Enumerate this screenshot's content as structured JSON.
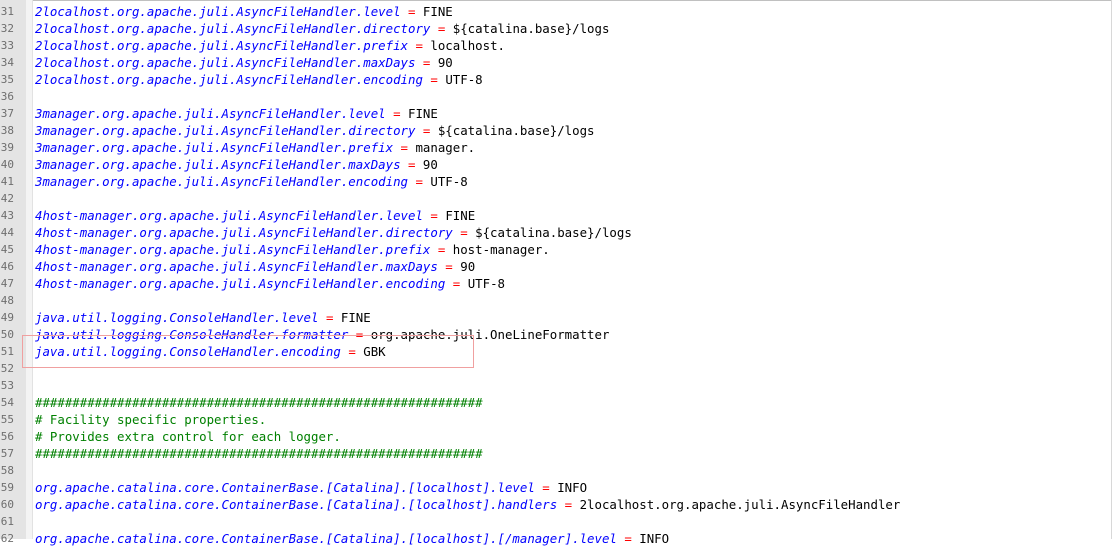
{
  "editor": {
    "lines": [
      {
        "no": "31",
        "key": "2localhost.org.apache.juli.AsyncFileHandler.level",
        "eq": " = ",
        "val": "FINE"
      },
      {
        "no": "32",
        "key": "2localhost.org.apache.juli.AsyncFileHandler.directory",
        "eq": " = ",
        "val": "${catalina.base}/logs"
      },
      {
        "no": "33",
        "key": "2localhost.org.apache.juli.AsyncFileHandler.prefix",
        "eq": " = ",
        "val": "localhost."
      },
      {
        "no": "34",
        "key": "2localhost.org.apache.juli.AsyncFileHandler.maxDays",
        "eq": " = ",
        "val": "90"
      },
      {
        "no": "35",
        "key": "2localhost.org.apache.juli.AsyncFileHandler.encoding",
        "eq": " = ",
        "val": "UTF-8"
      },
      {
        "no": "36",
        "key": "",
        "eq": "",
        "val": ""
      },
      {
        "no": "37",
        "key": "3manager.org.apache.juli.AsyncFileHandler.level",
        "eq": " = ",
        "val": "FINE"
      },
      {
        "no": "38",
        "key": "3manager.org.apache.juli.AsyncFileHandler.directory",
        "eq": " = ",
        "val": "${catalina.base}/logs"
      },
      {
        "no": "39",
        "key": "3manager.org.apache.juli.AsyncFileHandler.prefix",
        "eq": " = ",
        "val": "manager."
      },
      {
        "no": "40",
        "key": "3manager.org.apache.juli.AsyncFileHandler.maxDays",
        "eq": " = ",
        "val": "90"
      },
      {
        "no": "41",
        "key": "3manager.org.apache.juli.AsyncFileHandler.encoding",
        "eq": " = ",
        "val": "UTF-8"
      },
      {
        "no": "42",
        "key": "",
        "eq": "",
        "val": ""
      },
      {
        "no": "43",
        "key": "4host-manager.org.apache.juli.AsyncFileHandler.level",
        "eq": " = ",
        "val": "FINE"
      },
      {
        "no": "44",
        "key": "4host-manager.org.apache.juli.AsyncFileHandler.directory",
        "eq": " = ",
        "val": "${catalina.base}/logs"
      },
      {
        "no": "45",
        "key": "4host-manager.org.apache.juli.AsyncFileHandler.prefix",
        "eq": " = ",
        "val": "host-manager."
      },
      {
        "no": "46",
        "key": "4host-manager.org.apache.juli.AsyncFileHandler.maxDays",
        "eq": " = ",
        "val": "90"
      },
      {
        "no": "47",
        "key": "4host-manager.org.apache.juli.AsyncFileHandler.encoding",
        "eq": " = ",
        "val": "UTF-8"
      },
      {
        "no": "48",
        "key": "",
        "eq": "",
        "val": ""
      },
      {
        "no": "49",
        "key": "java.util.logging.ConsoleHandler.level",
        "eq": " = ",
        "val": "FINE"
      },
      {
        "no": "50",
        "key": "java.util.logging.ConsoleHandler.formatter",
        "eq": " = ",
        "val": "org.apache.juli.OneLineFormatter"
      },
      {
        "no": "51",
        "key": "java.util.logging.ConsoleHandler.encoding",
        "eq": " = ",
        "val": "GBK"
      },
      {
        "no": "52",
        "key": "",
        "eq": "",
        "val": ""
      },
      {
        "no": "53",
        "key": "",
        "eq": "",
        "val": ""
      },
      {
        "no": "54",
        "comment": "############################################################"
      },
      {
        "no": "55",
        "comment": "# Facility specific properties."
      },
      {
        "no": "56",
        "comment": "# Provides extra control for each logger."
      },
      {
        "no": "57",
        "comment": "############################################################"
      },
      {
        "no": "58",
        "key": "",
        "eq": "",
        "val": ""
      },
      {
        "no": "59",
        "key": "org.apache.catalina.core.ContainerBase.[Catalina].[localhost].level",
        "eq": " = ",
        "val": "INFO"
      },
      {
        "no": "60",
        "key": "org.apache.catalina.core.ContainerBase.[Catalina].[localhost].handlers",
        "eq": " = ",
        "val": "2localhost.org.apache.juli.AsyncFileHandler"
      },
      {
        "no": "61",
        "key": "",
        "eq": "",
        "val": ""
      },
      {
        "no": "62",
        "key": "org.apache.catalina.core.ContainerBase.[Catalina].[localhost].[/manager].level",
        "eq": " = ",
        "val": "INFO"
      }
    ]
  },
  "colors": {
    "key": "#0000ff",
    "operator": "#ff0000",
    "value": "#000000",
    "comment": "#008000",
    "highlight_border": "#f0a0a0",
    "gutter": "#e4e4e4"
  }
}
